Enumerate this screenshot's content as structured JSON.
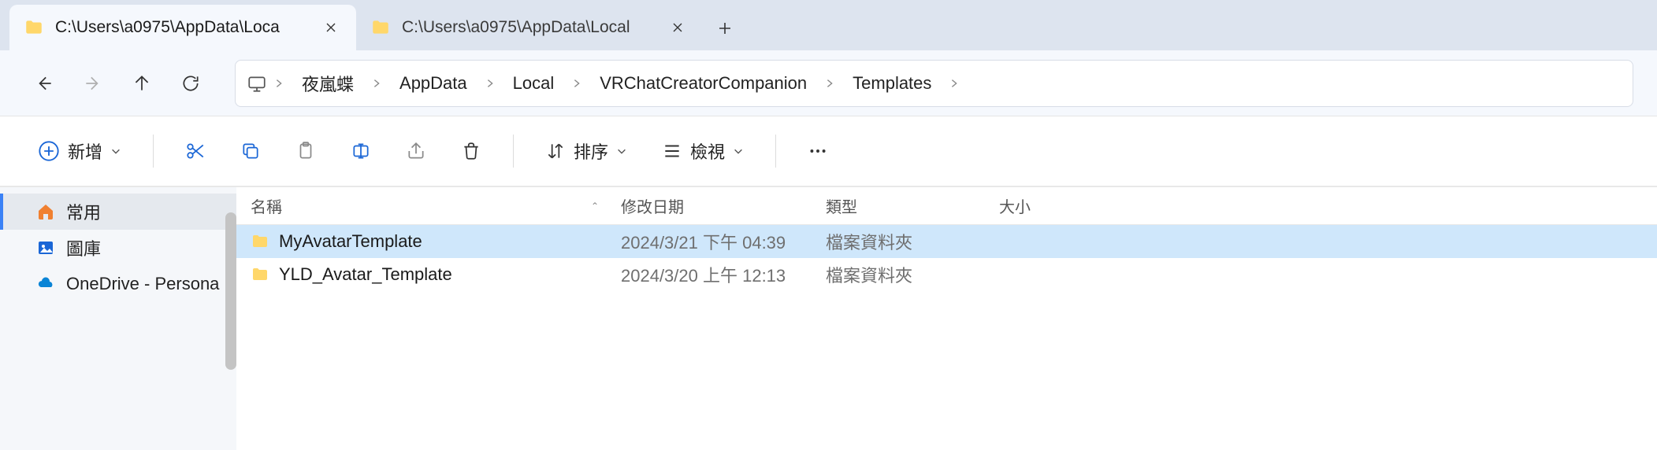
{
  "tabs": [
    {
      "title": "C:\\Users\\a0975\\AppData\\Loca",
      "active": true
    },
    {
      "title": "C:\\Users\\a0975\\AppData\\Local",
      "active": false
    }
  ],
  "breadcrumb": {
    "items": [
      "夜嵐蝶",
      "AppData",
      "Local",
      "VRChatCreatorCompanion",
      "Templates"
    ]
  },
  "toolbar": {
    "new_label": "新增",
    "sort_label": "排序",
    "view_label": "檢視"
  },
  "sidebar": {
    "items": [
      {
        "label": "常用",
        "icon": "home",
        "selected": true
      },
      {
        "label": "圖庫",
        "icon": "gallery",
        "selected": false
      },
      {
        "label": "OneDrive - Persona",
        "icon": "onedrive",
        "selected": false
      }
    ]
  },
  "columns": {
    "name": "名稱",
    "date": "修改日期",
    "type": "類型",
    "size": "大小"
  },
  "rows": [
    {
      "name": "MyAvatarTemplate",
      "date": "2024/3/21 下午 04:39",
      "type": "檔案資料夾",
      "size": "",
      "selected": true
    },
    {
      "name": "YLD_Avatar_Template",
      "date": "2024/3/20 上午 12:13",
      "type": "檔案資料夾",
      "size": "",
      "selected": false
    }
  ]
}
